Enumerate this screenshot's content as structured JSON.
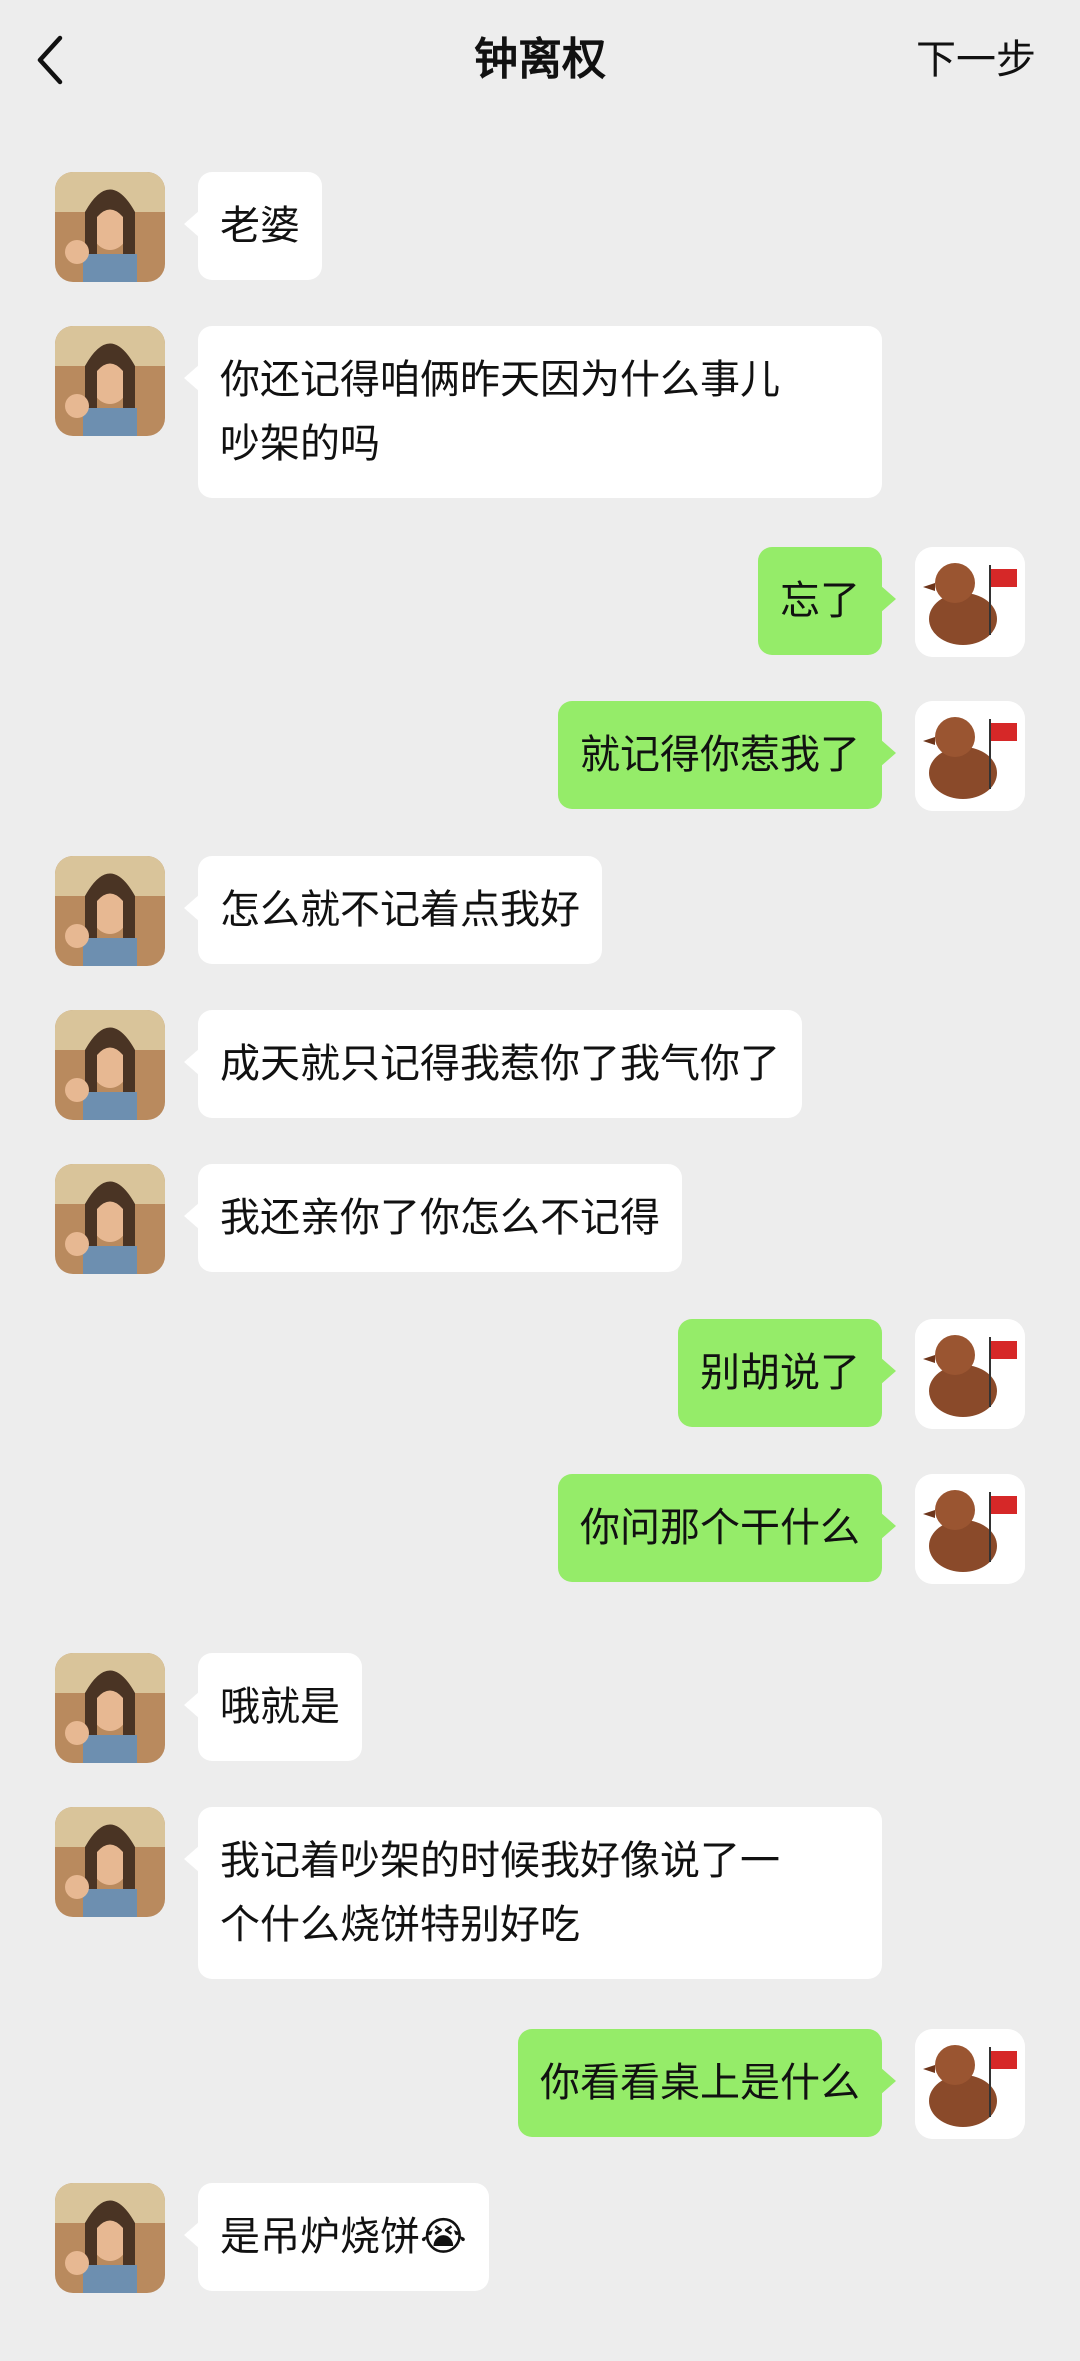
{
  "header": {
    "title": "钟离权",
    "next_label": "下一步"
  },
  "icons": {
    "back": "chevron-left-icon",
    "contact_avatar": "character-avatar",
    "self_avatar": "duck-avatar"
  },
  "colors": {
    "background": "#ededed",
    "incoming_bubble": "#ffffff",
    "outgoing_bubble": "#95ec69"
  },
  "messages": [
    {
      "side": "left",
      "text": "老婆"
    },
    {
      "side": "left",
      "text": "你还记得咱俩昨天因为什么事儿\n吵架的吗"
    },
    {
      "side": "right",
      "text": "忘了"
    },
    {
      "side": "right",
      "text": "就记得你惹我了"
    },
    {
      "side": "left",
      "text": "怎么就不记着点我好"
    },
    {
      "side": "left",
      "text": "成天就只记得我惹你了我气你了"
    },
    {
      "side": "left",
      "text": "我还亲你了你怎么不记得"
    },
    {
      "side": "right",
      "text": "别胡说了"
    },
    {
      "side": "right",
      "text": "你问那个干什么"
    },
    {
      "side": "left",
      "text": "哦就是"
    },
    {
      "side": "left",
      "text": "我记着吵架的时候我好像说了一\n个什么烧饼特别好吃"
    },
    {
      "side": "right",
      "text": "你看看桌上是什么"
    },
    {
      "side": "left",
      "text": "是吊炉烧饼😭"
    }
  ]
}
